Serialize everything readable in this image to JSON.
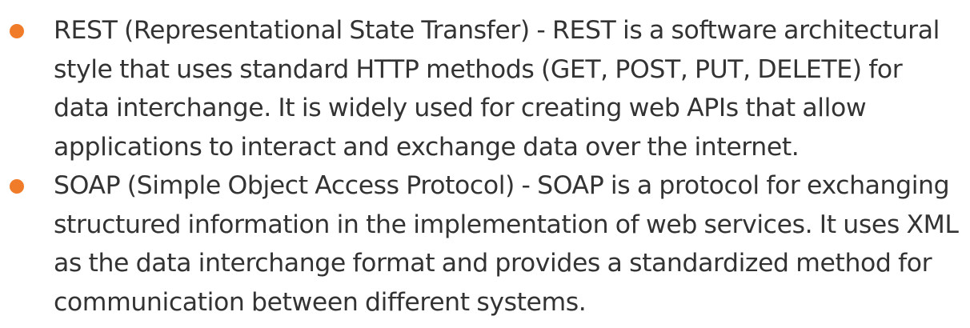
{
  "bullets": {
    "marker_color": "#f07c2a",
    "items": [
      {
        "text": "REST (Representational State Transfer) - REST is a software architectural style that uses standard HTTP methods (GET, POST, PUT, DELETE) for data interchange. It is widely used for creating web APIs that allow applications to interact and exchange data over the internet."
      },
      {
        "text": "SOAP (Simple Object Access Protocol) - SOAP is a protocol for exchanging structured information in the implementation of web services. It uses XML as the data interchange format and provides a standardized method for communication between different systems."
      }
    ]
  }
}
